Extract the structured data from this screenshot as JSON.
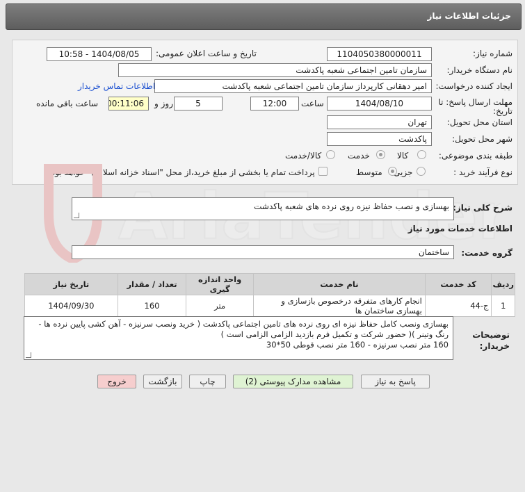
{
  "header": {
    "title": "جزئیات اطلاعات نیاز"
  },
  "form": {
    "need_number_label": "شماره نیاز:",
    "need_number": "1104050380000011",
    "announce_label": "تاریخ و ساعت اعلان عمومی:",
    "announce_value": "1404/08/05 - 10:58",
    "buyer_label": "نام دستگاه خریدار:",
    "buyer_value": "سازمان تامین اجتماعی شعبه پاکدشت",
    "creator_label": "ایجاد کننده درخواست:",
    "creator_value": "امیر دهقانی کارپرداز سازمان تامین اجتماعی شعبه پاکدشت",
    "contact_link": "اطلاعات تماس خریدار",
    "deadline_label_1": "مهلت ارسال پاسخ: تا",
    "deadline_label_2": "تاریخ:",
    "deadline_date": "1404/08/10",
    "time_label": "ساعت",
    "deadline_time": "12:00",
    "days_value": "5",
    "days_label": "روز و",
    "remaining_value": "00:11:06",
    "remaining_label": "ساعت باقی مانده",
    "province_label": "استان محل تحویل:",
    "province_value": "تهران",
    "city_label": "شهر محل تحویل:",
    "city_value": "پاکدشت",
    "category_label": "طبقه بندی موضوعی:",
    "category_options": [
      "کالا",
      "خدمت",
      "کالا/خدمت"
    ],
    "process_label": "نوع فرآیند خرید :",
    "process_options": [
      "جزیی",
      "متوسط"
    ],
    "payment_note": "پرداخت تمام یا بخشی از مبلغ خرید،از محل \"اسناد خزانه اسلامی\" خواهد بود."
  },
  "description": {
    "label": "شرح کلی نیاز:",
    "value": "بهسازی و نصب حفاظ نیزه روی نرده های شعبه پاکدشت"
  },
  "services": {
    "section_title": "اطلاعات خدمات مورد نیاز",
    "group_label": "گروه خدمت:",
    "group_value": "ساختمان",
    "columns": [
      "ردیف",
      "کد خدمت",
      "نام خدمت",
      "واحد اندازه گیری",
      "تعداد / مقدار",
      "تاریخ نیاز"
    ],
    "rows": [
      {
        "row": "1",
        "code": "ج-44",
        "name": "انجام کارهای متفرقه درخصوص بازسازی و بهسازی ساختمان ها",
        "unit": "متر",
        "qty": "160",
        "date": "1404/09/30"
      }
    ]
  },
  "buyer_notes": {
    "label_1": "توضیحات",
    "label_2": "خریدار:",
    "line1": "بهسازی ونصب کامل حفاظ نیزه ای روی نرده های تامین اجتماعی پاکدشت ( خرید ونصب سرنیزه - آهن کشی پایین نرده ها -",
    "line2": "رنگ وتینر )( حضور شرکت و تکمیل فرم بازدید الزامی الزامی است )",
    "line3": "160 متر نصب سرنیزه - 160 متر نصب قوطی 50*30"
  },
  "buttons": {
    "reply": "پاسخ به نیاز",
    "attachments": "مشاهده مدارک پیوستی (2)",
    "print": "چاپ",
    "back": "بازگشت",
    "exit": "خروج"
  },
  "watermark": {
    "text": "AriaTender.net"
  },
  "colors": {
    "accent_link": "#1a4fd0",
    "exit_button": "#f6cece",
    "attachments_button": "#dff3d3",
    "remaining_bg": "#ffffc8"
  }
}
